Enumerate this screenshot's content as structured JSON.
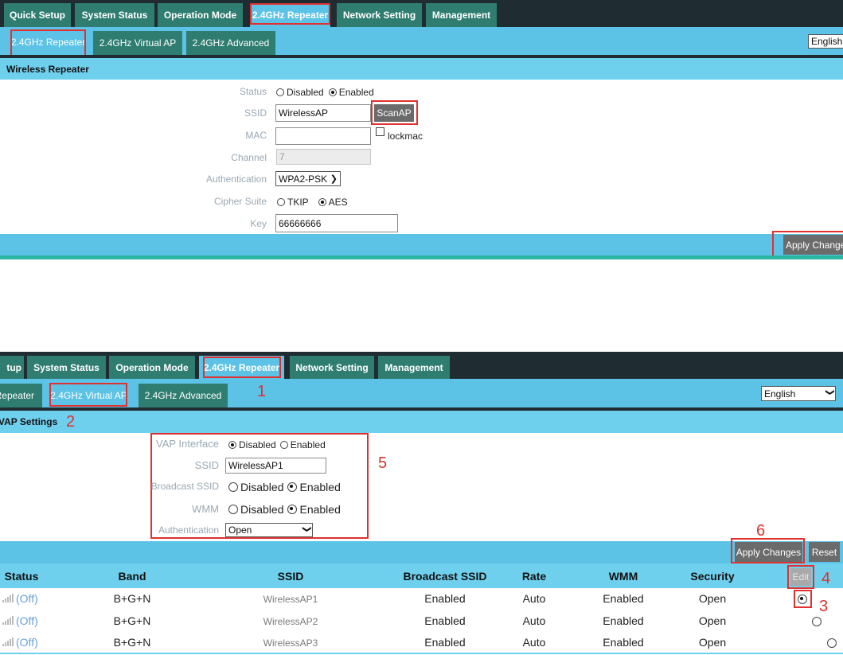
{
  "top": {
    "main_tabs": [
      "Quick Setup",
      "System Status",
      "Operation Mode",
      "2.4GHz Repeater",
      "Network Setting",
      "Management"
    ],
    "sub_tabs": [
      "2.4GHz Repeater",
      "2.4GHz Virtual AP",
      "2.4GHz Advanced"
    ],
    "language": "English",
    "section_title": "Wireless Repeater",
    "form": {
      "status_label": "Status",
      "status_options": [
        "Disabled",
        "Enabled"
      ],
      "status_selected": "Enabled",
      "ssid_label": "SSID",
      "ssid_value": "WirelessAP",
      "scan_button": "ScanAP",
      "mac_label": "MAC",
      "mac_value": "",
      "lockmac_label": "lockmac",
      "channel_label": "Channel",
      "channel_value": "7",
      "auth_label": "Authentication",
      "auth_value": "WPA2-PSK",
      "cipher_label": "Cipher Suite",
      "cipher_options": [
        "TKIP",
        "AES"
      ],
      "cipher_selected": "AES",
      "key_label": "Key",
      "key_value": "66666666"
    },
    "apply_button": "Apply Changes"
  },
  "bottom": {
    "main_tabs": [
      "Quick Setup",
      "System Status",
      "Operation Mode",
      "2.4GHz Repeater",
      "Network Setting",
      "Management"
    ],
    "main_tab_first_visible": "tup",
    "sub_tabs": [
      "Repeater",
      "2.4GHz Virtual AP",
      "2.4GHz Advanced"
    ],
    "language": "English",
    "section_title": "VAP Settings",
    "form": {
      "vap_label": "VAP Interface",
      "vap_options": [
        "Disabled",
        "Enabled"
      ],
      "vap_selected": "Disabled",
      "ssid_label": "SSID",
      "ssid_value": "WirelessAP1",
      "broadcast_label": "Broadcast SSID",
      "broadcast_options": [
        "Disabled",
        "Enabled"
      ],
      "broadcast_selected": "Enabled",
      "wmm_label": "WMM",
      "wmm_options": [
        "Disabled",
        "Enabled"
      ],
      "wmm_selected": "Enabled",
      "auth_label": "Authentication",
      "auth_value": "Open"
    },
    "apply_button": "Apply Changes",
    "reset_button": "Reset",
    "edit_button": "Edit",
    "table": {
      "headers": [
        "Status",
        "Band",
        "SSID",
        "Broadcast SSID",
        "Rate",
        "WMM",
        "Security"
      ],
      "rows": [
        {
          "status": "(Off)",
          "band": "B+G+N",
          "ssid": "WirelessAP1",
          "broadcast": "Enabled",
          "rate": "Auto",
          "wmm": "Enabled",
          "security": "Open",
          "selected": true
        },
        {
          "status": "(Off)",
          "band": "B+G+N",
          "ssid": "WirelessAP2",
          "broadcast": "Enabled",
          "rate": "Auto",
          "wmm": "Enabled",
          "security": "Open",
          "selected": false
        },
        {
          "status": "(Off)",
          "band": "B+G+N",
          "ssid": "WirelessAP3",
          "broadcast": "Enabled",
          "rate": "Auto",
          "wmm": "Enabled",
          "security": "Open",
          "selected": false
        }
      ]
    }
  },
  "annotations": [
    "1",
    "2",
    "3",
    "4",
    "5",
    "6"
  ],
  "colors": {
    "accent": "#5cc3e6",
    "tab": "#2f7d70",
    "dark": "#1f2d33",
    "highlight": "#e03030"
  }
}
